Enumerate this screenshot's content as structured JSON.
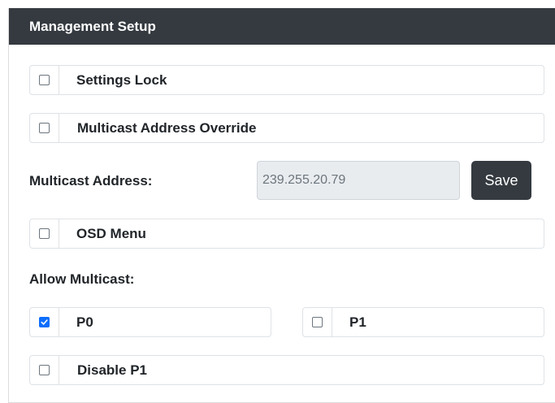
{
  "header": {
    "title": "Management Setup"
  },
  "options": {
    "settings_lock": {
      "label": "Settings Lock",
      "checked": false
    },
    "multicast_override": {
      "label": "Multicast Address Override",
      "checked": false
    },
    "osd_menu": {
      "label": "OSD Menu",
      "checked": false
    },
    "p0": {
      "label": "P0",
      "checked": true
    },
    "p1": {
      "label": "P1",
      "checked": false
    },
    "disable_p1": {
      "label": "Disable P1",
      "checked": false
    }
  },
  "multicast": {
    "label": "Multicast Address:",
    "value": "239.255.20.79",
    "save_label": "Save"
  },
  "allow_multicast": {
    "label": "Allow Multicast:"
  },
  "colors": {
    "header_bg": "#343a40",
    "checked": "#0d6efd",
    "input_bg": "#e9ecef"
  }
}
